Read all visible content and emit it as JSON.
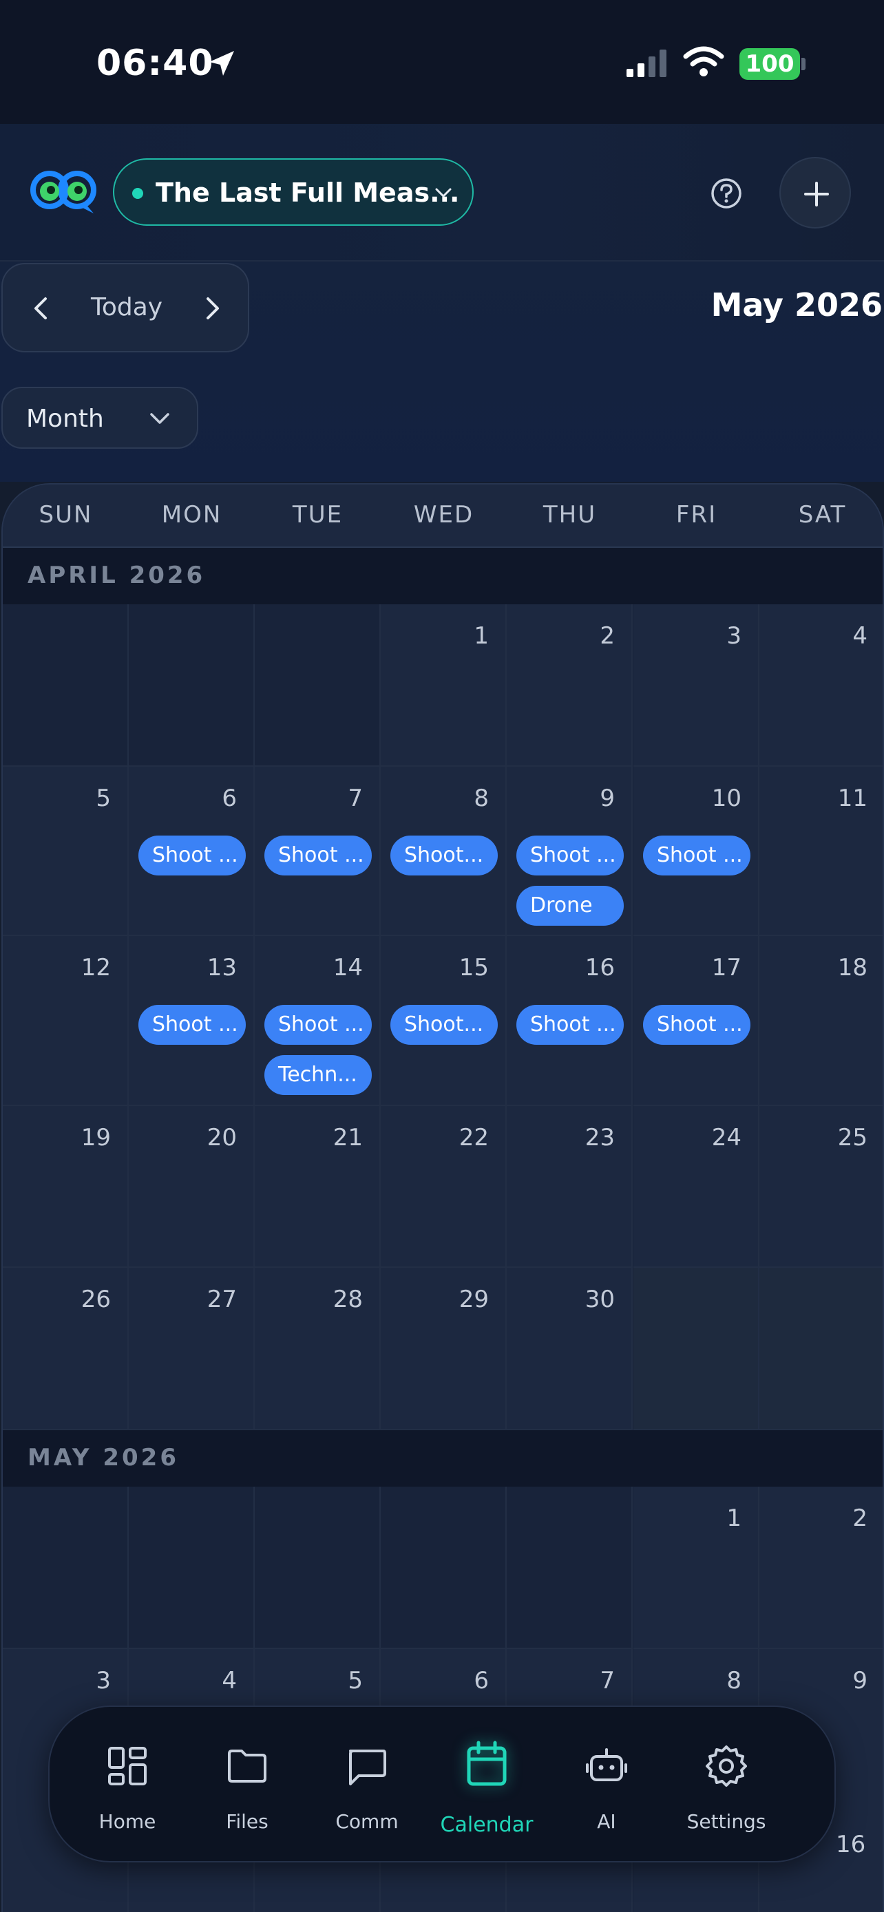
{
  "status_bar": {
    "time": "06:40",
    "battery": "100",
    "icons": [
      "location-arrow-icon",
      "cellular-signal-icon",
      "wifi-icon",
      "battery-icon"
    ]
  },
  "header": {
    "project_name": "The Last Full Meas...",
    "project_status_color": "#20d6b8",
    "icons": [
      "app-logo",
      "chevron-down-icon",
      "help-icon",
      "plus-icon"
    ]
  },
  "controls": {
    "today_label": "Today",
    "month_title": "May 2026",
    "view_label": "Month"
  },
  "calendar": {
    "weekdays": [
      "SUN",
      "MON",
      "TUE",
      "WED",
      "THU",
      "FRI",
      "SAT"
    ],
    "april_label": "APRIL 2026",
    "may_label": "MAY 2026",
    "april_weeks": [
      [
        "",
        "",
        "",
        "1",
        "2",
        "3",
        "4"
      ],
      [
        "5",
        "6",
        "7",
        "8",
        "9",
        "10",
        "11"
      ],
      [
        "12",
        "13",
        "14",
        "15",
        "16",
        "17",
        "18"
      ],
      [
        "19",
        "20",
        "21",
        "22",
        "23",
        "24",
        "25"
      ],
      [
        "26",
        "27",
        "28",
        "29",
        "30",
        "",
        ""
      ]
    ],
    "may_weeks": [
      [
        "",
        "",
        "",
        "",
        "",
        "1",
        "2"
      ],
      [
        "3",
        "4",
        "5",
        "6",
        "7",
        "8",
        "9"
      ]
    ],
    "events": {
      "apr6": [
        "Shoot ..."
      ],
      "apr7": [
        "Shoot ..."
      ],
      "apr8": [
        "Shoot..."
      ],
      "apr9": [
        "Shoot ...",
        "Drone"
      ],
      "apr10": [
        "Shoot ..."
      ],
      "apr13": [
        "Shoot ..."
      ],
      "apr14": [
        "Shoot ...",
        "Techn..."
      ],
      "apr15": [
        "Shoot..."
      ],
      "apr16": [
        "Shoot ..."
      ],
      "apr17": [
        "Shoot ..."
      ]
    },
    "event_color": "#3b82f6",
    "extra_day": "16"
  },
  "tab_bar": {
    "tabs": [
      {
        "label": "Home",
        "icon": "home-grid-icon"
      },
      {
        "label": "Files",
        "icon": "folder-icon"
      },
      {
        "label": "Comm",
        "icon": "chat-bubble-icon"
      },
      {
        "label": "Calendar",
        "icon": "calendar-icon"
      },
      {
        "label": "AI",
        "icon": "robot-icon"
      },
      {
        "label": "Settings",
        "icon": "gear-icon"
      }
    ],
    "active": "Calendar",
    "accent_color": "#20d6b8"
  }
}
